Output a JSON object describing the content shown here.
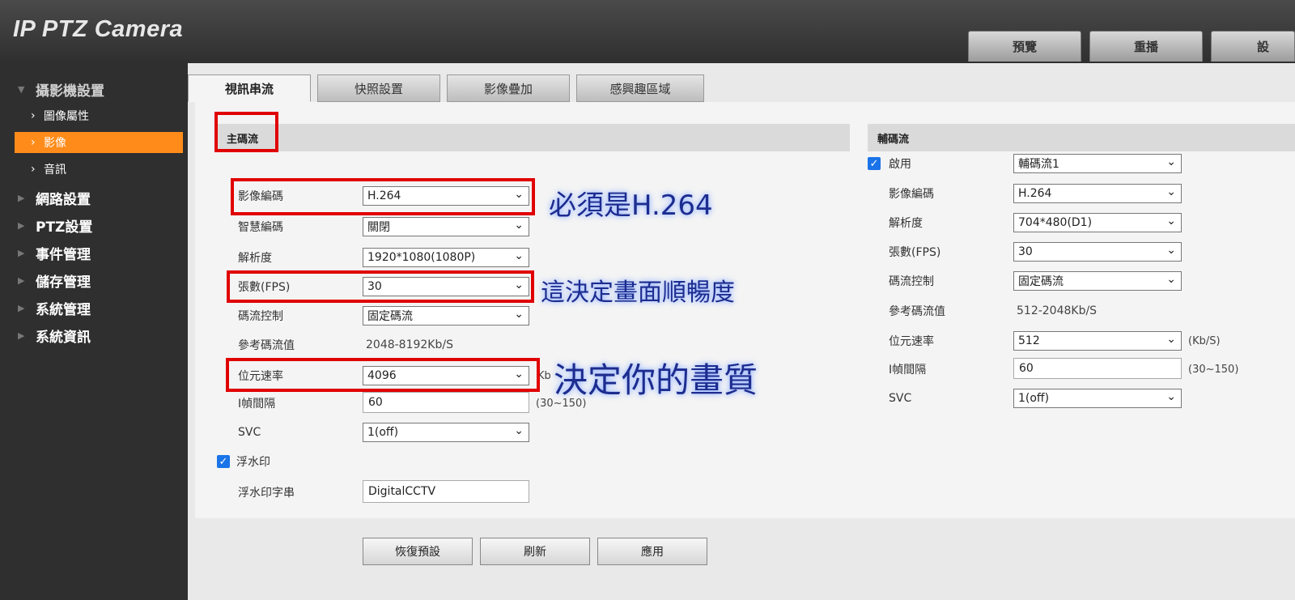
{
  "header": {
    "title": "IP PTZ Camera",
    "tabs": [
      {
        "label": "預覽"
      },
      {
        "label": "重播"
      },
      {
        "label": "設"
      }
    ]
  },
  "sidebar": {
    "groups": [
      {
        "label": "攝影機設置",
        "expanded": true
      },
      {
        "label": "網路設置"
      },
      {
        "label": "PTZ設置"
      },
      {
        "label": "事件管理"
      },
      {
        "label": "儲存管理"
      },
      {
        "label": "系統管理"
      },
      {
        "label": "系統資訊"
      }
    ],
    "sub_items": [
      {
        "label": "圖像屬性"
      },
      {
        "label": "影像",
        "active": true
      },
      {
        "label": "音訊"
      }
    ]
  },
  "subtabs": [
    {
      "label": "視訊串流",
      "active": true
    },
    {
      "label": "快照設置"
    },
    {
      "label": "影像疊加"
    },
    {
      "label": "感興趣區域"
    }
  ],
  "main_stream": {
    "heading": "主碼流",
    "rows": {
      "encode": {
        "label": "影像編碼",
        "value": "H.264"
      },
      "smart": {
        "label": "智慧編碼",
        "value": "關閉"
      },
      "resolution": {
        "label": "解析度",
        "value": "1920*1080(1080P)"
      },
      "fps": {
        "label": "張數(FPS)",
        "value": "30"
      },
      "bitrate_ctrl": {
        "label": "碼流控制",
        "value": "固定碼流"
      },
      "ref_bitrate": {
        "label": "參考碼流值",
        "value": "2048-8192Kb/S"
      },
      "bitrate": {
        "label": "位元速率",
        "value": "4096",
        "unit": "Kb"
      },
      "iframe": {
        "label": "I幀間隔",
        "value": "60",
        "range": "(30~150)"
      },
      "svc": {
        "label": "SVC",
        "value": "1(off)"
      }
    },
    "watermark": {
      "label": "浮水印",
      "checked": true
    },
    "watermark_string": {
      "label": "浮水印字串",
      "value": "DigitalCCTV"
    }
  },
  "sub_stream": {
    "heading": "輔碼流",
    "enable": {
      "label": "啟用",
      "checked": true,
      "value": "輔碼流1"
    },
    "rows": {
      "encode": {
        "label": "影像編碼",
        "value": "H.264"
      },
      "resolution": {
        "label": "解析度",
        "value": "704*480(D1)"
      },
      "fps": {
        "label": "張數(FPS)",
        "value": "30"
      },
      "bitrate_ctrl": {
        "label": "碼流控制",
        "value": "固定碼流"
      },
      "ref_bitrate": {
        "label": "參考碼流值",
        "value": "512-2048Kb/S"
      },
      "bitrate": {
        "label": "位元速率",
        "value": "512",
        "unit": "(Kb/S)"
      },
      "iframe": {
        "label": "I幀間隔",
        "value": "60",
        "range": "(30~150)"
      },
      "svc": {
        "label": "SVC",
        "value": "1(off)"
      }
    }
  },
  "buttons": {
    "reset": "恢復預設",
    "refresh": "刷新",
    "apply": "應用"
  },
  "annotations": {
    "encode_note": "必須是H.264",
    "fps_note": "這決定畫面順暢度",
    "bitrate_note": "決定你的畫質"
  },
  "colors": {
    "accent": "#ff8c1a",
    "highlight_box": "#e00000",
    "annotation_text": "#1d2c8f",
    "checkbox": "#1a73e8"
  }
}
